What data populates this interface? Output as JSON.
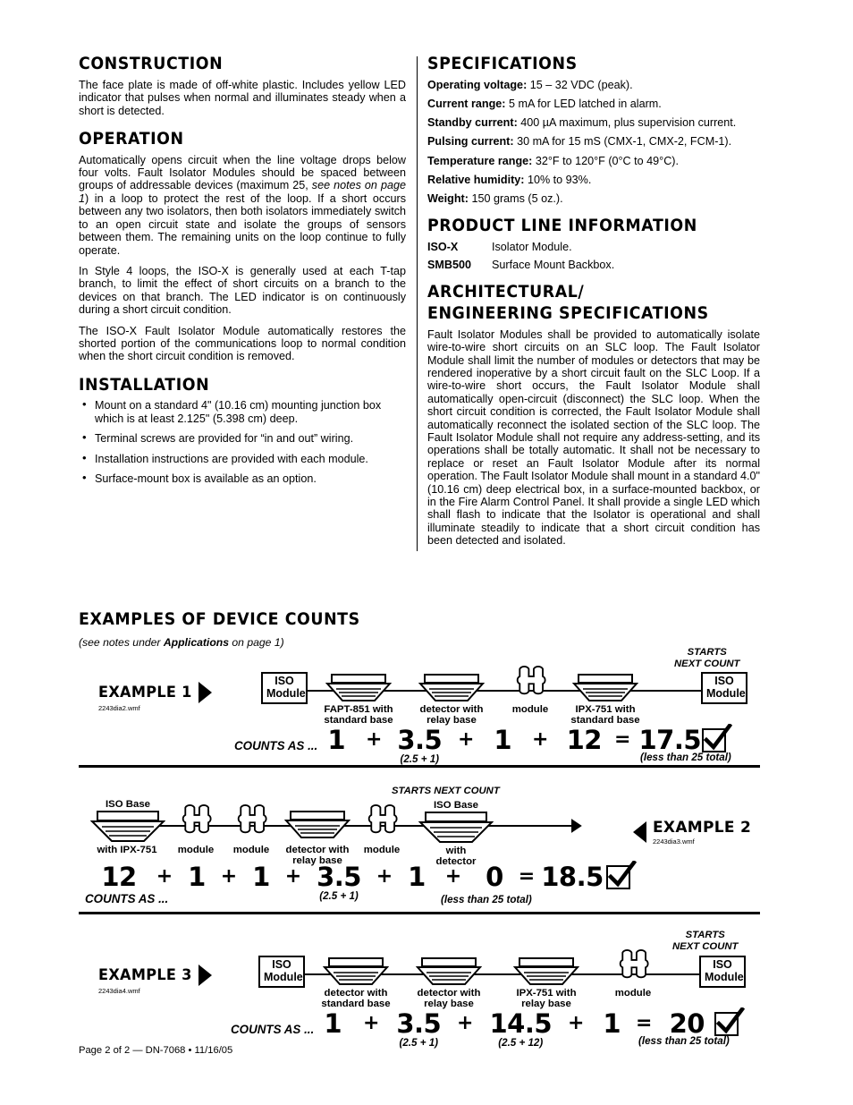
{
  "left_column": {
    "sections": [
      {
        "heading": "CONSTRUCTION",
        "paragraphs": [
          "The face plate is made of off-white plastic. Includes yellow LED indicator that pulses when normal and illuminates steady when a short is detected."
        ]
      },
      {
        "heading": "OPERATION",
        "paragraphs": [
          "Automatically opens circuit when the line voltage drops below four volts. Fault Isolator Modules should be spaced between groups of addressable devices (maximum 25, <i>see notes on page 1</i>) in a loop to protect the rest of the loop. If a short occurs between any two isolators, then both isolators immediately switch to an open circuit state and isolate the groups of sensors between them. The remaining units on the loop continue to fully operate.",
          "In Style 4 loops, the ISO-X is generally used at each T-tap branch, to limit the effect of short circuits on a branch to the devices on that branch. The LED indicator is on continuously during a short circuit condition.",
          "The ISO-X Fault Isolator Module automatically restores the shorted portion of the communications loop to normal condition when the short circuit condition is removed."
        ]
      },
      {
        "heading": "INSTALLATION",
        "bullets": [
          "Mount on a standard 4\" (10.16 cm) mounting junction box which is at least 2.125\" (5.398 cm) deep.",
          "Terminal screws are provided for “in and out” wiring.",
          "Installation instructions are provided with each module.",
          "Surface-mount box is available as an option."
        ]
      }
    ]
  },
  "right_column": {
    "specifications": {
      "heading": "SPECIFICATIONS",
      "items": [
        {
          "key": "Operating voltage:",
          "value": "15 – 32 VDC (peak)."
        },
        {
          "key": "Current range:",
          "value": " 5 mA for LED latched in alarm."
        },
        {
          "key": "Standby current:",
          "value": "400 µA maximum, plus supervision current."
        },
        {
          "key": "Pulsing current:",
          "value": "30 mA for 15 mS (CMX-1, CMX-2, FCM-1)."
        },
        {
          "key": "Temperature range:",
          "value": "32°F to 120°F (0°C to 49°C)."
        },
        {
          "key": "Relative humidity:",
          "value": "10% to 93%."
        },
        {
          "key": "Weight:",
          "value": "150 grams (5 oz.)."
        }
      ]
    },
    "product_line": {
      "heading": "PRODUCT LINE INFORMATION",
      "items": [
        {
          "code": "ISO-X",
          "desc": "Isolator Module."
        },
        {
          "code": "SMB500",
          "desc": "Surface Mount Backbox."
        }
      ]
    },
    "architectural": {
      "heading_line1": "ARCHITECTURAL/",
      "heading_line2": "ENGINEERING SPECIFICATIONS",
      "paragraph": "Fault Isolator Modules shall be provided to automatically isolate wire-to-wire short circuits on an SLC loop. The Fault Isolator Module shall limit the number of modules or detectors that may be rendered inoperative by a short circuit fault on the SLC Loop. If a wire-to-wire short occurs, the Fault Isolator Module shall automatically open-circuit (disconnect) the SLC loop. When the short circuit condition is corrected, the Fault Isolator Module shall automatically reconnect the isolated section of the SLC loop. The Fault Isolator Module shall not require any address-setting, and its operations shall be totally automatic. It shall not be necessary to replace or reset an Fault Isolator Module after its normal operation. The Fault Isolator Module shall mount in a standard 4.0\" (10.16 cm) deep electrical box, in a surface-mounted backbox, or in the Fire Alarm Control Panel. It shall provide a single LED which shall flash to indicate that the Isolator is operational and shall illuminate steadily to indicate that a short circuit condition has been detected and isolated."
    }
  },
  "examples_section": {
    "heading": "EXAMPLES OF DEVICE COUNTS",
    "subtitle_pre": "(see notes under ",
    "subtitle_bold": "Applications",
    "subtitle_post": " on page 1)",
    "examples": [
      {
        "label": "EXAMPLE 1",
        "wmf": "2243dia2.wmf",
        "arrow": "right",
        "starts_next_count": "STARTS\nNEXT COUNT",
        "start_box": "ISO\nModule",
        "end_box": "ISO\nModule",
        "devices": [
          {
            "type": "detector",
            "label": "FAPT-851 with\nstandard base"
          },
          {
            "type": "detector",
            "label": "detector with\nrelay base"
          },
          {
            "type": "module",
            "label": "module"
          },
          {
            "type": "detector",
            "label": "IPX-751 with\nstandard base"
          }
        ],
        "counts_as": "COUNTS AS ...",
        "terms": [
          {
            "num": "1",
            "sub": ""
          },
          {
            "num": "3.5",
            "sub": "(2.5 + 1)"
          },
          {
            "num": "1",
            "sub": ""
          },
          {
            "num": "12",
            "sub": ""
          }
        ],
        "total": "17.5",
        "note": "(less than 25 total)"
      },
      {
        "label": "EXAMPLE 2",
        "wmf": "2243dia3.wmf",
        "arrow": "left",
        "starts_next_count": "STARTS NEXT COUNT",
        "devices": [
          {
            "type": "isobase",
            "label_top": "ISO Base",
            "label": "with IPX-751"
          },
          {
            "type": "module",
            "label": "module"
          },
          {
            "type": "module",
            "label": "module"
          },
          {
            "type": "detector",
            "label": "detector with\nrelay base"
          },
          {
            "type": "module",
            "label": "module"
          },
          {
            "type": "isobase",
            "label_top": "ISO Base",
            "label": "with\ndetector"
          }
        ],
        "counts_as": "COUNTS AS ...",
        "terms": [
          {
            "num": "12",
            "sub": ""
          },
          {
            "num": "1",
            "sub": ""
          },
          {
            "num": "1",
            "sub": ""
          },
          {
            "num": "3.5",
            "sub": "(2.5 + 1)"
          },
          {
            "num": "1",
            "sub": ""
          },
          {
            "num": "0",
            "sub": ""
          }
        ],
        "total": "18.5",
        "note": "(less than 25 total)"
      },
      {
        "label": "EXAMPLE 3",
        "wmf": "2243dia4.wmf",
        "arrow": "right",
        "starts_next_count": "STARTS\nNEXT COUNT",
        "start_box": "ISO\nModule",
        "end_box": "ISO\nModule",
        "devices": [
          {
            "type": "detector",
            "label": "detector with\nstandard base"
          },
          {
            "type": "detector",
            "label": "detector with\nrelay base"
          },
          {
            "type": "detector",
            "label": "IPX-751 with\nrelay base"
          },
          {
            "type": "module",
            "label": "module"
          }
        ],
        "counts_as": "COUNTS AS ...",
        "terms": [
          {
            "num": "1",
            "sub": ""
          },
          {
            "num": "3.5",
            "sub": "(2.5 + 1)"
          },
          {
            "num": "14.5",
            "sub": "(2.5 + 12)"
          },
          {
            "num": "1",
            "sub": ""
          }
        ],
        "total": "20",
        "note": "(less than 25 total)"
      }
    ]
  },
  "footer": "Page 2 of 2  —  DN-7068 • 11/16/05"
}
